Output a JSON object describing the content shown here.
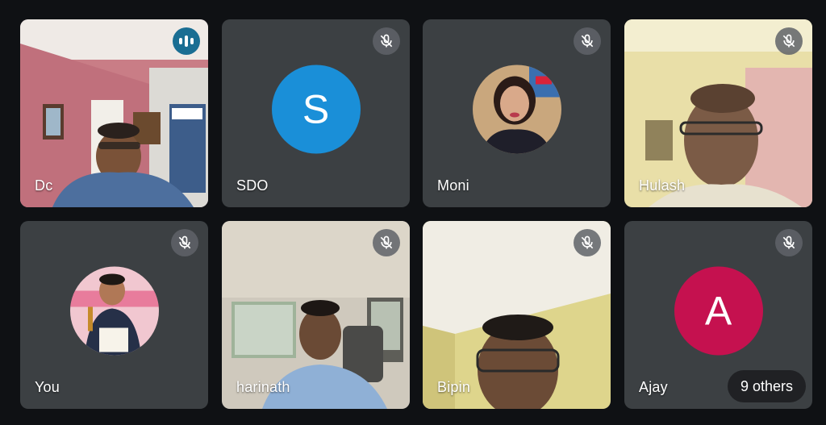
{
  "participants": [
    {
      "name": "Dc",
      "status": "speaking"
    },
    {
      "name": "SDO",
      "status": "muted",
      "avatar_letter": "S",
      "avatar_color": "#1a8fd8"
    },
    {
      "name": "Moni",
      "status": "muted"
    },
    {
      "name": "Hulash",
      "status": "muted"
    },
    {
      "name": "You",
      "status": "muted"
    },
    {
      "name": "harinath",
      "status": "muted"
    },
    {
      "name": "Bipin",
      "status": "muted"
    },
    {
      "name": "Ajay",
      "status": "muted",
      "avatar_letter": "A",
      "avatar_color": "#c5114f"
    }
  ],
  "others_label": "9 others",
  "colors": {
    "tile_bg": "#3c4043",
    "active_border": "#1a6e93",
    "page_bg": "#0f1114"
  }
}
